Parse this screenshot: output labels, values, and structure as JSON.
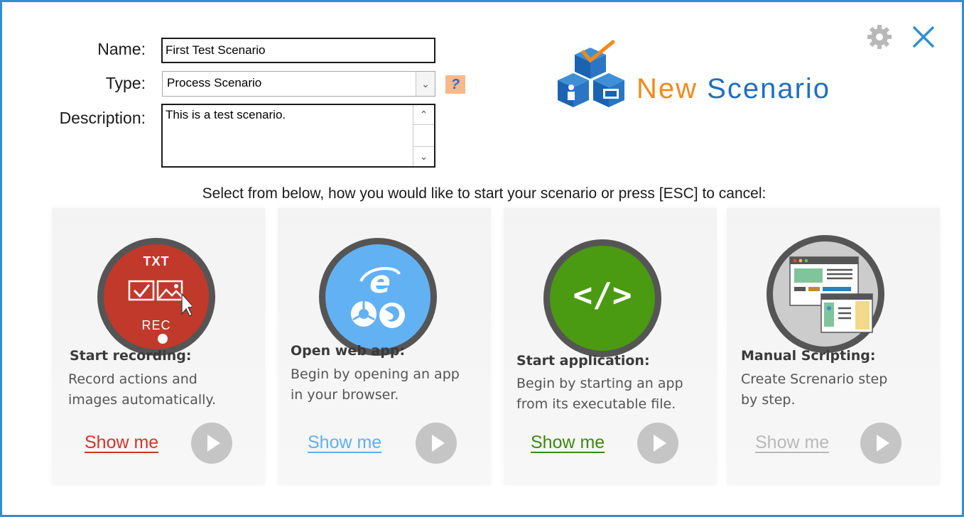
{
  "form": {
    "name_label": "Name:",
    "name_value": "First Test Scenario",
    "type_label": "Type:",
    "type_value": "Process Scenario",
    "help_glyph": "?",
    "description_label": "Description:",
    "description_value": "This is a test scenario."
  },
  "header": {
    "title_part1": "New",
    "title_part2": "Scenario"
  },
  "instruction": "Select from below, how you would like to start your scenario or press [ESC] to cancel:",
  "options": [
    {
      "title": "Start recording:",
      "desc_line1": "Record actions and",
      "desc_line2": "images automatically.",
      "link": "Show me",
      "link_color": "#d0362b",
      "icon": "record-icon",
      "icon_txt": "TXT",
      "icon_rec": "REC"
    },
    {
      "title": "Open web app:",
      "desc_line1": "Begin by opening an app",
      "desc_line2": "in your browser.",
      "link": "Show me",
      "link_color": "#62aef0",
      "icon": "browsers-icon"
    },
    {
      "title": "Start application:",
      "desc_line1": "Begin by starting an app",
      "desc_line2": "from its executable file.",
      "link": "Show me",
      "link_color": "#3c8a0e",
      "icon": "code-icon",
      "icon_code": "</>"
    },
    {
      "title": "Manual Scripting:",
      "desc_line1": "Create Screnario step",
      "desc_line2": "by step.",
      "link": "Show me",
      "link_color": "#b9b9b9",
      "icon": "windows-icon"
    }
  ],
  "colors": {
    "border": "#2e8fd4",
    "record": "#c0392b",
    "web": "#62b1f3",
    "code": "#4a9a12",
    "manual": "#cccccc"
  }
}
